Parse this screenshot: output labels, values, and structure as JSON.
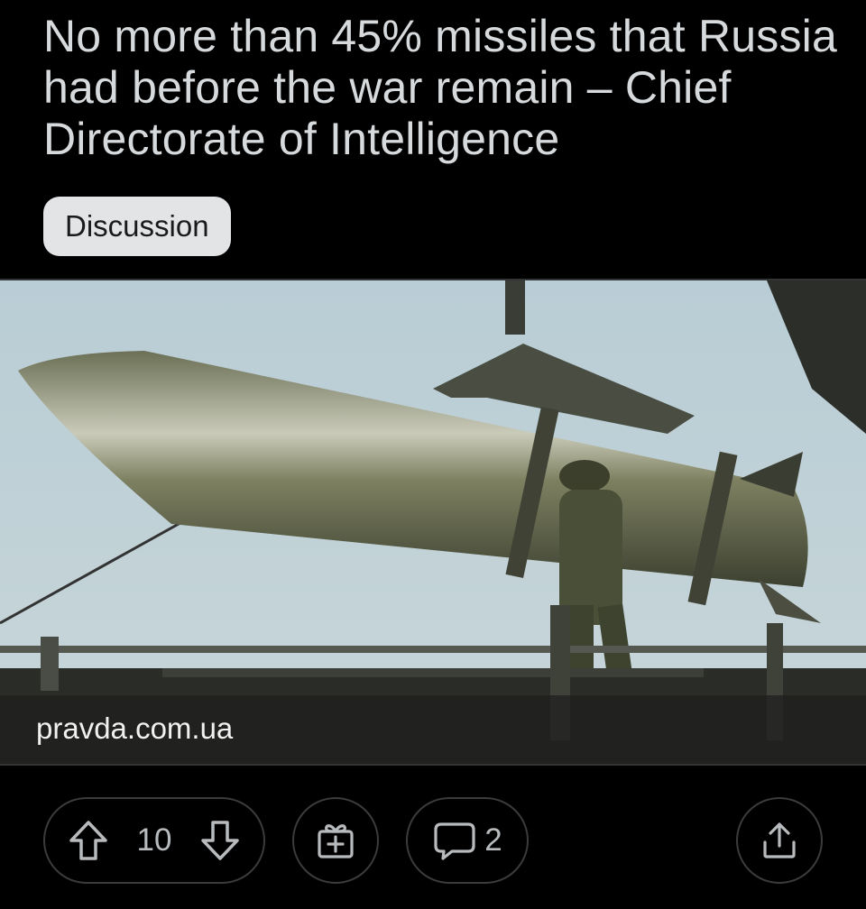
{
  "post": {
    "title": "No more than 45% missiles that Russia had before the war remain – Chief Directorate of Intelligence",
    "flair": "Discussion",
    "link_domain": "pravda.com.ua",
    "votes": "10",
    "comments": "2"
  },
  "icons": {
    "upvote": "upvote-arrow-icon",
    "downvote": "downvote-arrow-icon",
    "award": "gift-icon",
    "comments": "comment-bubble-icon",
    "share": "share-icon"
  },
  "colors": {
    "background": "#000000",
    "text": "#d7dadc",
    "flair_bg": "#e3e4e6",
    "border": "#3a3b3c"
  }
}
